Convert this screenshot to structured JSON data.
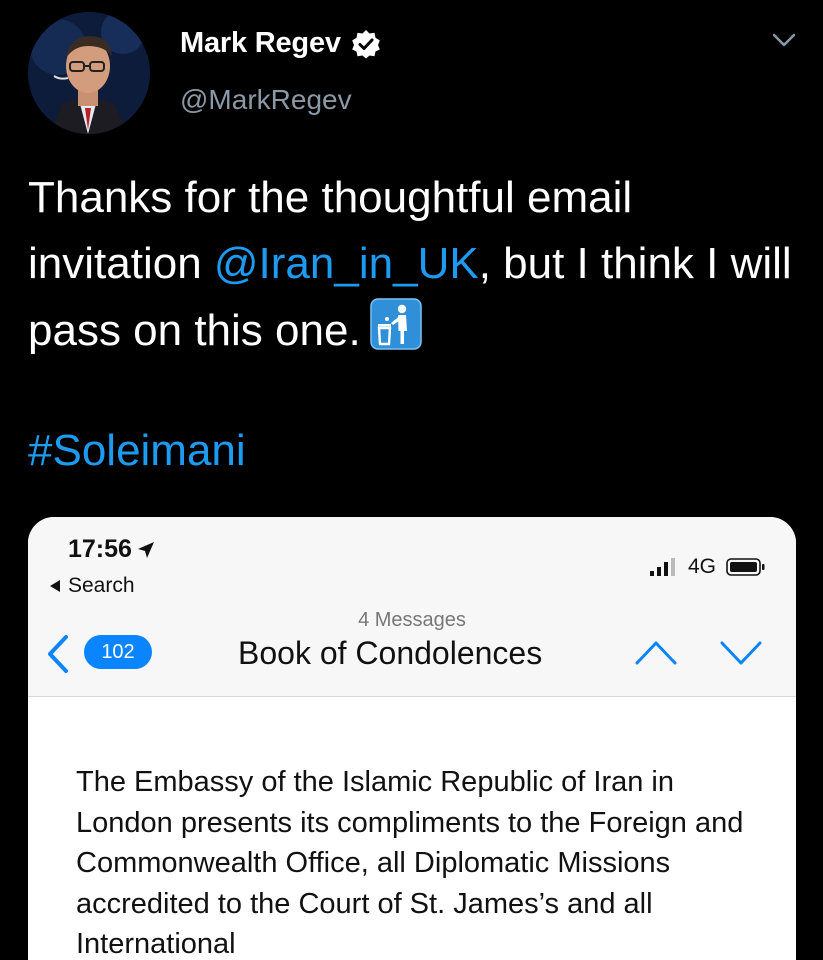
{
  "author": {
    "display_name": "Mark Regev",
    "handle": "@MarkRegev",
    "verified": true
  },
  "tweet": {
    "text_before": "Thanks for the thoughtful email invitation ",
    "mention": "@Iran_in_UK",
    "text_after": ", but I think I will pass on this one.",
    "emoji": "litter-in-bin-icon",
    "hashtag": "#Soleimani"
  },
  "embedded_screenshot": {
    "status_bar": {
      "time": "17:56",
      "back_label": "Search",
      "network": "4G"
    },
    "mail_header": {
      "message_count": "4 Messages",
      "subject": "Book of Condolences",
      "unread_badge": "102"
    },
    "body_text": "The Embassy of the Islamic Republic of Iran in London presents its compliments to the Foreign and Commonwealth Office, all Diplomatic Missions accredited to the Court of St. James’s and all International"
  },
  "colors": {
    "background": "#000000",
    "link": "#1d9bf0",
    "ios_blue": "#0a84ff",
    "handle_gray": "#8b98a5"
  }
}
